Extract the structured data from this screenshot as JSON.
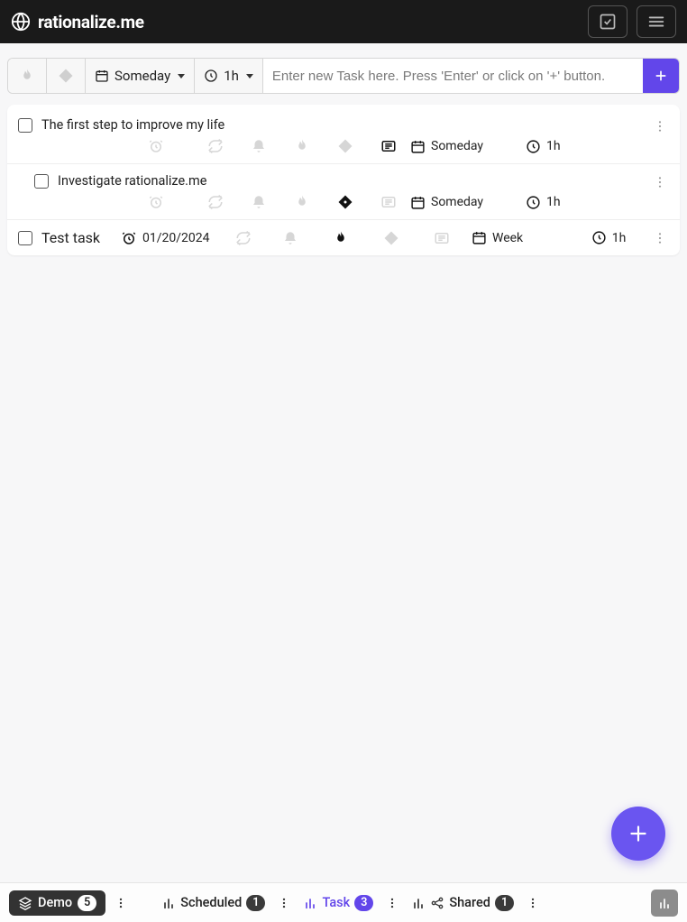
{
  "header": {
    "brand": "rationalize.me"
  },
  "toolbar": {
    "date_label": "Someday",
    "duration_label": "1h",
    "new_task_placeholder": "Enter new Task here. Press 'Enter' or click on '+' button."
  },
  "tasks": [
    {
      "title": "The first step to improve my life",
      "alarm_date": null,
      "notes_active": true,
      "flame_active": false,
      "priority_active": false,
      "date_label": "Someday",
      "duration": "1h",
      "indented": false,
      "two_line": true
    },
    {
      "title": "Investigate rationalize.me",
      "alarm_date": null,
      "notes_active": false,
      "flame_active": false,
      "priority_active": true,
      "date_label": "Someday",
      "duration": "1h",
      "indented": true,
      "two_line": true
    },
    {
      "title": "Test task",
      "alarm_date": "01/20/2024",
      "notes_active": false,
      "flame_active": true,
      "priority_active": false,
      "date_label": "Week",
      "duration": "1h",
      "indented": false,
      "two_line": false
    }
  ],
  "footer": {
    "demo_label": "Demo",
    "demo_count": "5",
    "scheduled_label": "Scheduled",
    "scheduled_count": "1",
    "task_label": "Task",
    "task_count": "3",
    "shared_label": "Shared",
    "shared_count": "1"
  }
}
